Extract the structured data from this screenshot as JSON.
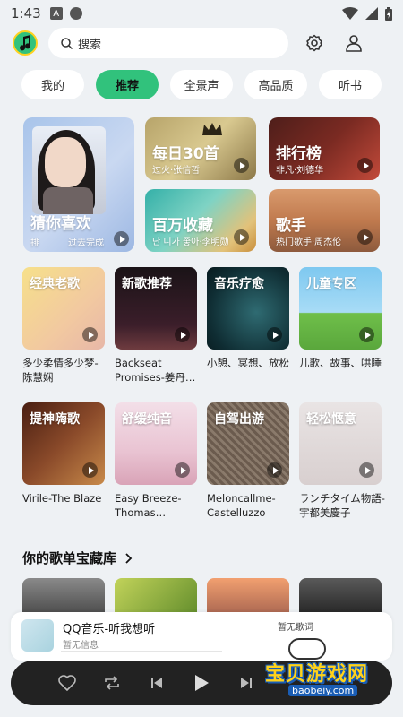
{
  "status_bar": {
    "time": "1:43",
    "badge": "A"
  },
  "header": {
    "search_placeholder": "搜索"
  },
  "tabs": [
    {
      "label": "我的",
      "active": false
    },
    {
      "label": "推荐",
      "active": true
    },
    {
      "label": "全景声",
      "active": false
    },
    {
      "label": "高品质",
      "active": false
    },
    {
      "label": "听书",
      "active": false
    }
  ],
  "features": {
    "guess": {
      "title": "猜你喜欢",
      "sub_left": "排",
      "sub_right": "过去完成"
    },
    "daily": {
      "title": "每日30首",
      "sub": "过火·张信哲"
    },
    "charts": {
      "title": "排行榜",
      "sub": "非凡·刘德华"
    },
    "million": {
      "title": "百万收藏",
      "sub": "난 니가 좋아·李明勋"
    },
    "singer": {
      "title": "歌手",
      "sub": "热门歌手·周杰伦"
    }
  },
  "playlists_row1": [
    {
      "tag": "经典老歌",
      "name": "多少柔情多少梦-陈慧娴"
    },
    {
      "tag": "新歌推荐",
      "name": "Backseat Promises-姜丹…"
    },
    {
      "tag": "音乐疗愈",
      "name": "小憩、冥想、放松"
    },
    {
      "tag": "儿童专区",
      "name": "儿歌、故事、哄睡"
    }
  ],
  "playlists_row2": [
    {
      "tag": "提神嗨歌",
      "name": "Virile-The Blaze"
    },
    {
      "tag": "舒缓纯音",
      "name": "Easy Breeze-Thomas…"
    },
    {
      "tag": "自驾出游",
      "name": "Meloncallme-Castelluzzo"
    },
    {
      "tag": "轻松惬意",
      "name": "ランチタイム物語-宇都美慶子"
    }
  ],
  "section": {
    "title": "你的歌单宝藏库"
  },
  "mini_player": {
    "title": "QQ音乐-听我想听",
    "subtitle": "暂无信息",
    "right_text": "暂无歌词"
  },
  "watermark": {
    "text": "宝贝游戏网",
    "url": "baobeiy.com"
  },
  "colors": {
    "accent": "#31c27c",
    "background": "#eef1f4"
  }
}
